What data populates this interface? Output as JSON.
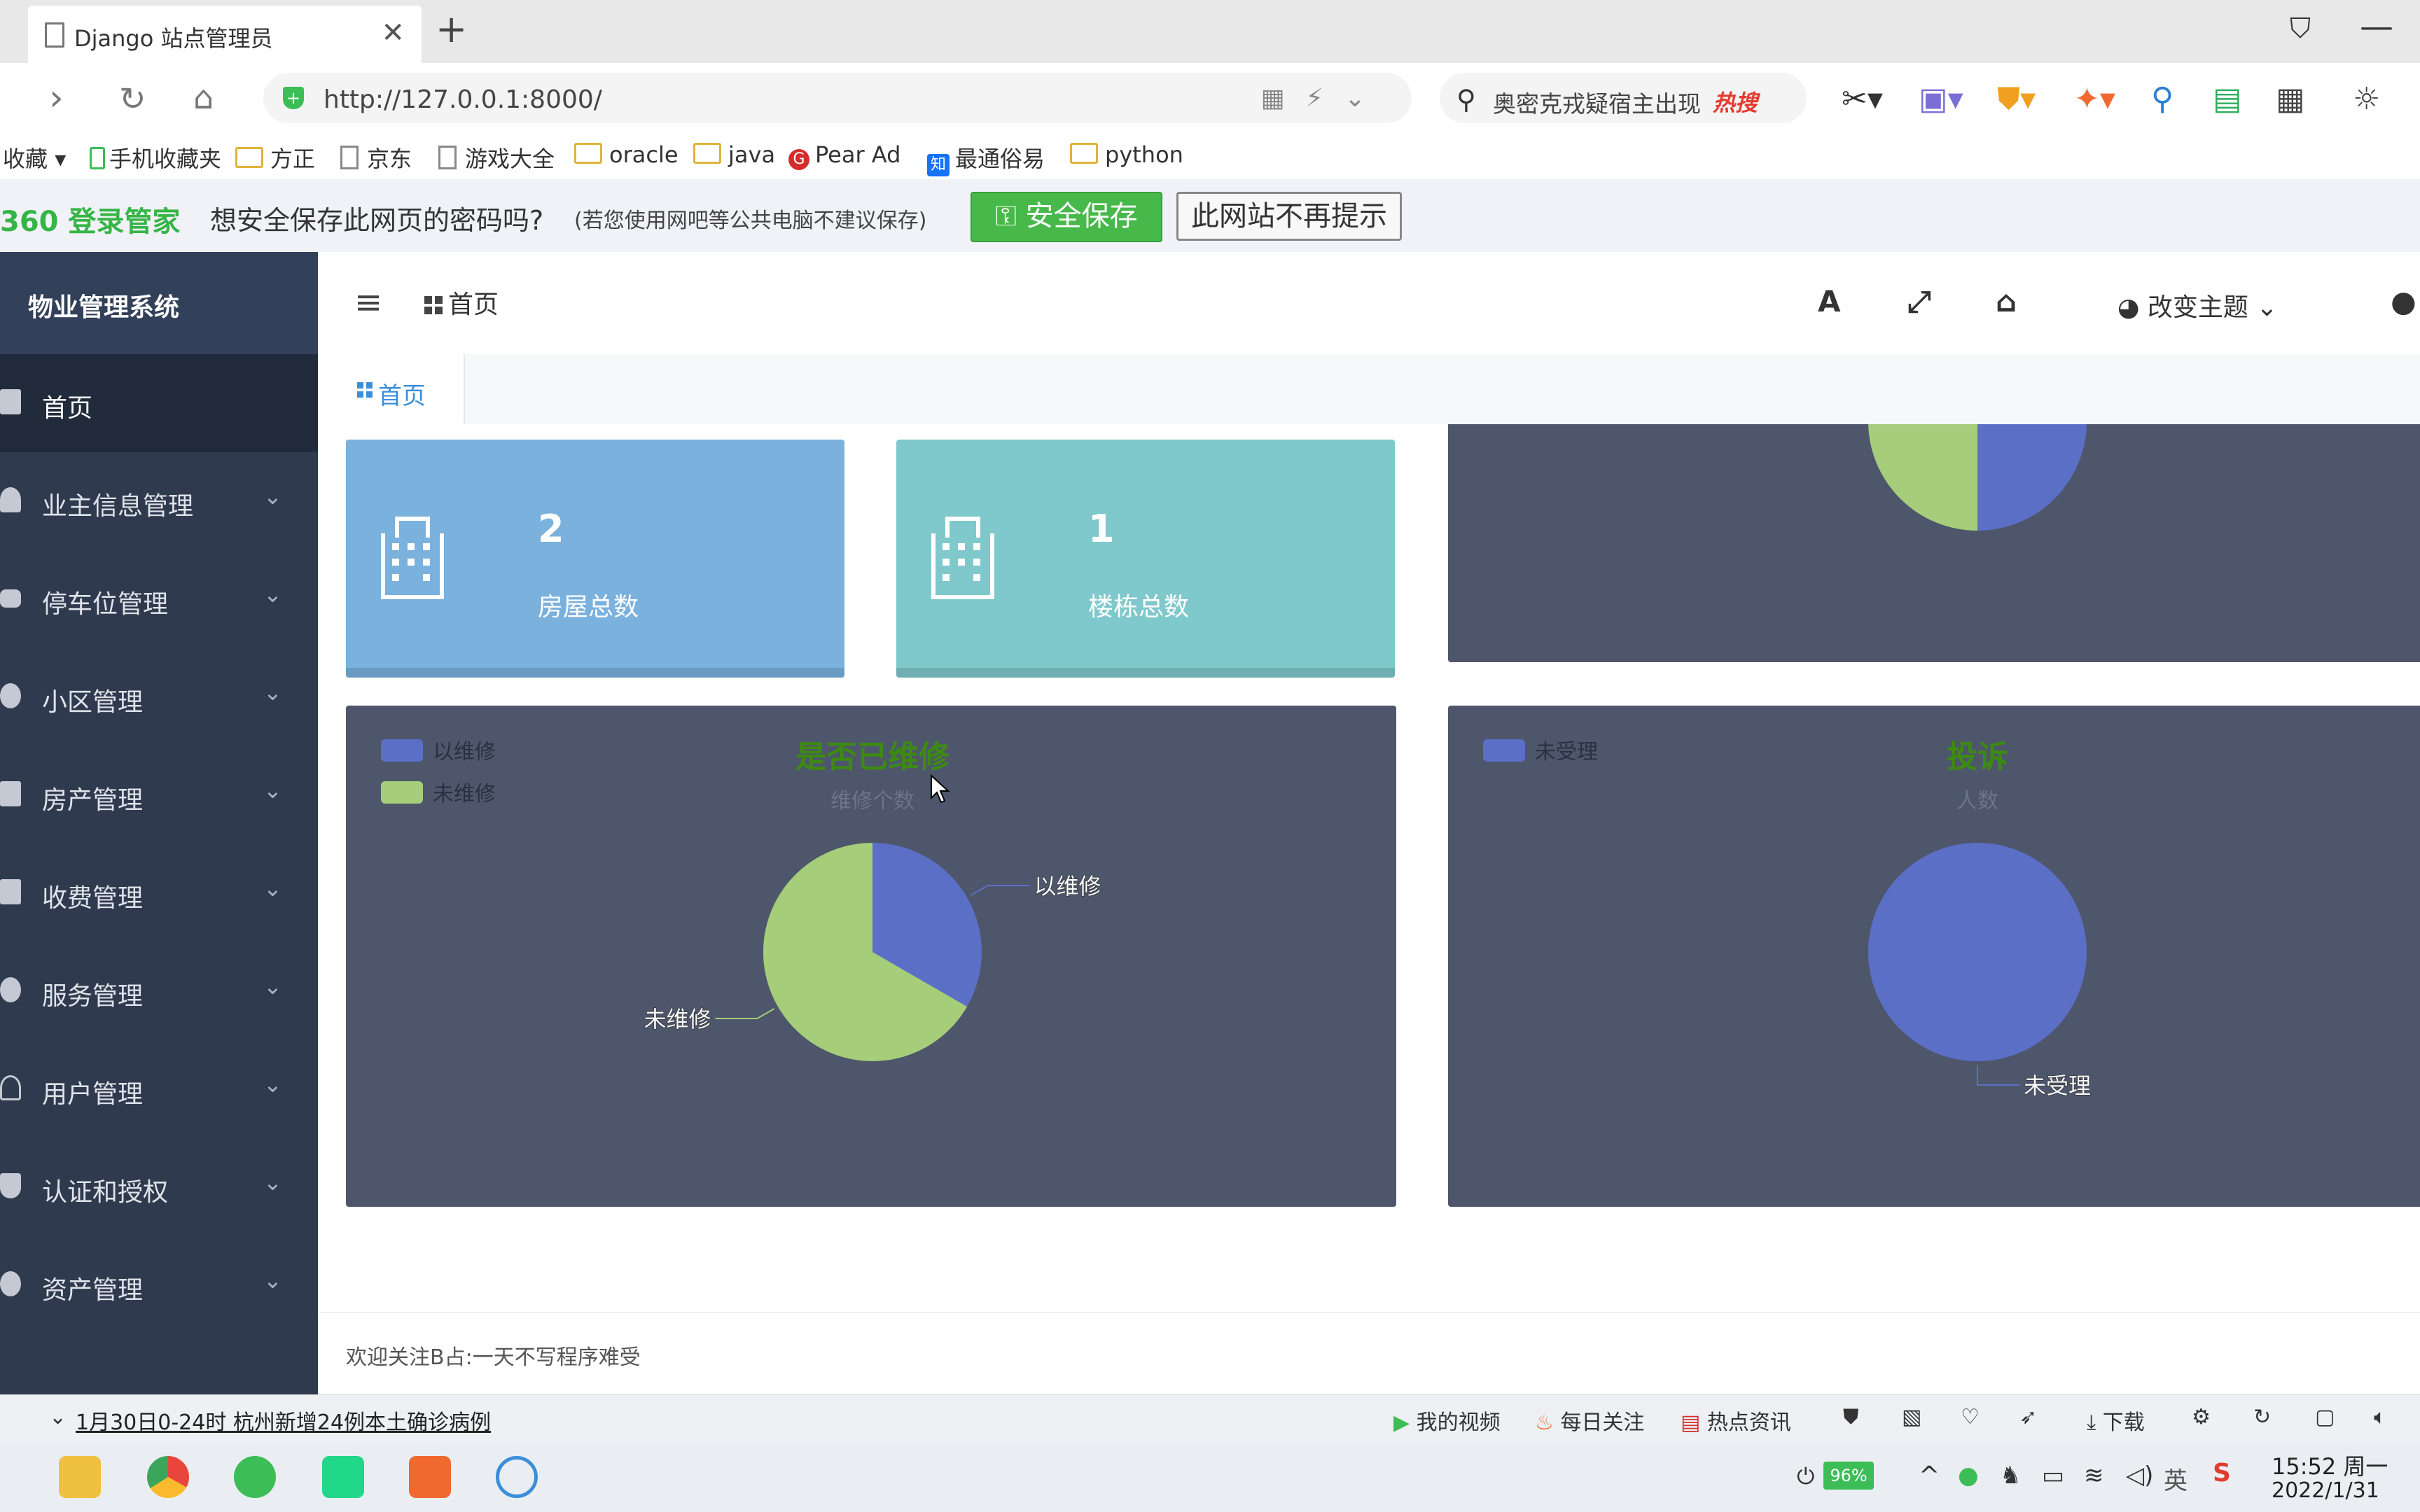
{
  "browser": {
    "tab_title": "Django 站点管理员",
    "url": "http://127.0.0.1:8000/",
    "search_text": "奥密克戎疑宿主出现",
    "search_hot": "热搜",
    "bookmarks": [
      "收藏",
      "手机收藏夹",
      "方正",
      "京东",
      "游戏大全",
      "oracle",
      "java",
      "Pear Ad",
      "最通俗易",
      "python"
    ]
  },
  "password_bar": {
    "logo": "360 登录管家",
    "question": "想安全保存此网页的密码吗?",
    "hint": "(若您使用网吧等公共电脑不建议保存)",
    "save_label": "安全保存",
    "never_label": "此网站不再提示"
  },
  "app": {
    "brand": "物业管理系统",
    "menu": [
      {
        "label": "首页",
        "active": true
      },
      {
        "label": "业主信息管理"
      },
      {
        "label": "停车位管理"
      },
      {
        "label": "小区管理"
      },
      {
        "label": "房产管理"
      },
      {
        "label": "收费管理"
      },
      {
        "label": "服务管理"
      },
      {
        "label": "用户管理"
      },
      {
        "label": "认证和授权"
      },
      {
        "label": "资产管理"
      }
    ],
    "breadcrumb": "首页",
    "theme_label": "改变主题",
    "tab_label": "首页",
    "footer": "欢迎关注B占:一天不写程序难受"
  },
  "stats": [
    {
      "value": "2",
      "label": "房屋总数",
      "color": "#7ab1dd"
    },
    {
      "value": "1",
      "label": "楼栋总数",
      "color": "#7fc8cb"
    }
  ],
  "chart_data": [
    {
      "type": "pie",
      "title": "",
      "partial": true,
      "values": [
        1,
        1
      ],
      "colors": [
        "#5b6fc7",
        "#a5cd7a"
      ]
    },
    {
      "type": "pie",
      "title": "是否已维修",
      "subtitle": "维修个数",
      "categories": [
        "以维修",
        "未维修"
      ],
      "values": [
        1,
        2
      ],
      "colors": [
        "#5b6fc7",
        "#a5cd7a"
      ],
      "legend": "top-left"
    },
    {
      "type": "pie",
      "title": "投诉",
      "subtitle": "人数",
      "categories": [
        "未受理"
      ],
      "values": [
        1
      ],
      "colors": [
        "#5b6fc7"
      ],
      "legend": "top-left"
    }
  ],
  "status_bar": {
    "news": "1月30日0-24时 杭州新增24例本土确诊病例",
    "items": [
      "我的视频",
      "每日关注",
      "热点资讯",
      "下载"
    ]
  },
  "taskbar": {
    "battery": "96%",
    "time": "15:52 周一",
    "date": "2022/1/31",
    "ime": "英"
  }
}
